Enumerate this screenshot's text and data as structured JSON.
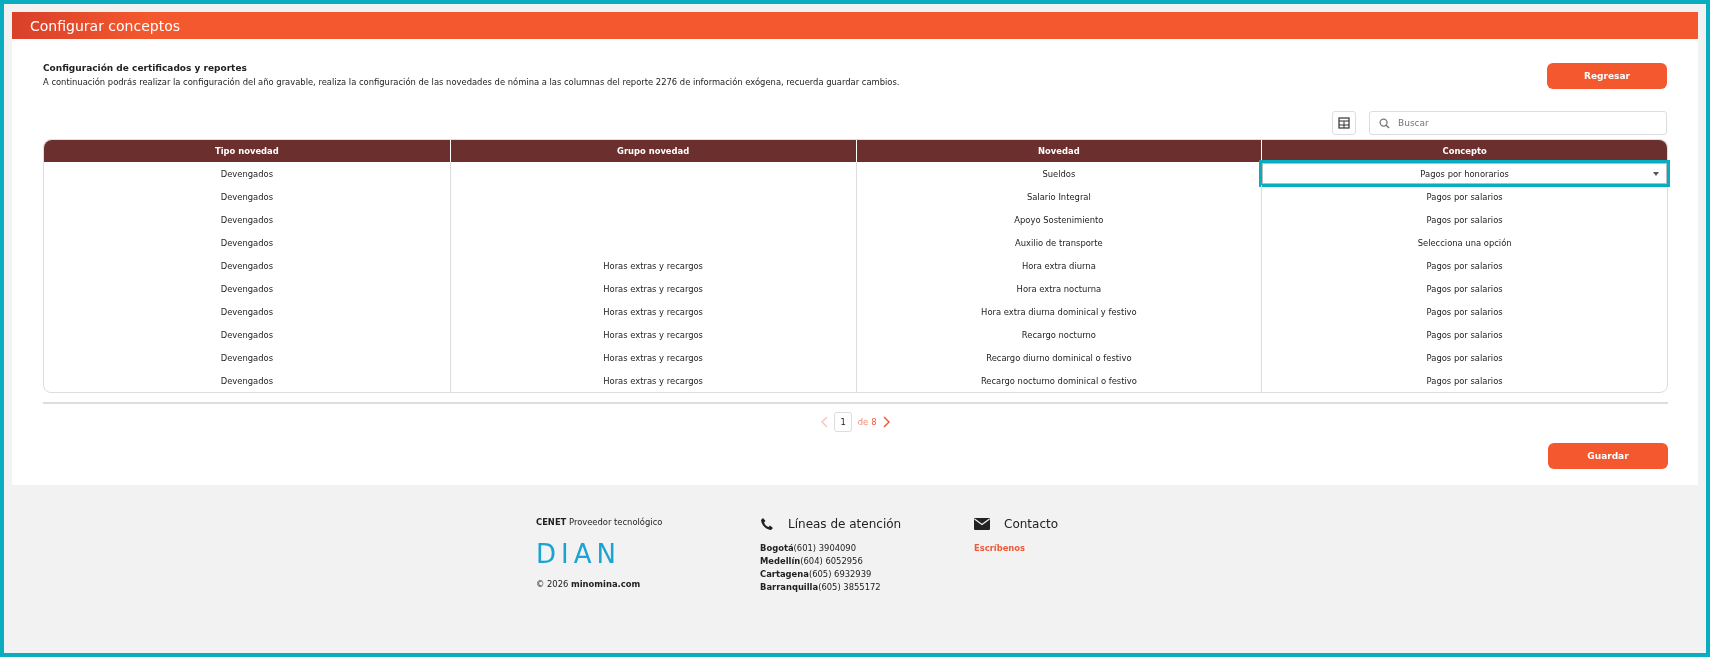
{
  "header": {
    "title": "Configurar conceptos"
  },
  "intro": {
    "heading": "Configuración de certificados y reportes",
    "text": "A continuación podrás realizar la configuración del año gravable, realiza la configuración de las novedades de nómina a las columnas del reporte 2276 de información exógena, recuerda guardar cambios."
  },
  "back_button": "Regresar",
  "search": {
    "placeholder": "Buscar"
  },
  "table": {
    "columns": [
      "Tipo novedad",
      "Grupo novedad",
      "Novedad",
      "Concepto"
    ],
    "rows": [
      {
        "tipo": "Devengados",
        "grupo": "",
        "novedad": "Sueldos",
        "concepto": {
          "kind": "select",
          "value": "Pagos por honorarios",
          "focused": true
        }
      },
      {
        "tipo": "Devengados",
        "grupo": "",
        "novedad": "Salario Integral",
        "concepto": {
          "kind": "text",
          "value": "Pagos por salarios"
        }
      },
      {
        "tipo": "Devengados",
        "grupo": "",
        "novedad": "Apoyo Sostenimiento",
        "concepto": {
          "kind": "text",
          "value": "Pagos por salarios"
        }
      },
      {
        "tipo": "Devengados",
        "grupo": "",
        "novedad": "Auxilio de transporte",
        "concepto": {
          "kind": "text",
          "value": "Selecciona una opción"
        }
      },
      {
        "tipo": "Devengados",
        "grupo": "Horas extras y recargos",
        "novedad": "Hora extra diurna",
        "concepto": {
          "kind": "text",
          "value": "Pagos por salarios"
        }
      },
      {
        "tipo": "Devengados",
        "grupo": "Horas extras y recargos",
        "novedad": "Hora extra nocturna",
        "concepto": {
          "kind": "text",
          "value": "Pagos por salarios"
        }
      },
      {
        "tipo": "Devengados",
        "grupo": "Horas extras y recargos",
        "novedad": "Hora extra diurna dominical y festivo",
        "concepto": {
          "kind": "text",
          "value": "Pagos por salarios"
        }
      },
      {
        "tipo": "Devengados",
        "grupo": "Horas extras y recargos",
        "novedad": "Recargo nocturno",
        "concepto": {
          "kind": "text",
          "value": "Pagos por salarios"
        }
      },
      {
        "tipo": "Devengados",
        "grupo": "Horas extras y recargos",
        "novedad": "Recargo diurno dominical o festivo",
        "concepto": {
          "kind": "text",
          "value": "Pagos por salarios"
        }
      },
      {
        "tipo": "Devengados",
        "grupo": "Horas extras y recargos",
        "novedad": "Recargo nocturno dominical o festivo",
        "concepto": {
          "kind": "text",
          "value": "Pagos por salarios"
        }
      }
    ]
  },
  "pagination": {
    "page": "1",
    "of": "de",
    "total": "8",
    "prev_disabled": true
  },
  "save_button": "Guardar",
  "footer": {
    "provider": "**CENET** Proveedor tecnológico",
    "logo": "DIAN",
    "copyright": "© 2026 **minomina.com**",
    "lines_title": "Líneas de atención",
    "lines": [
      "**Bogotá**(601) 3904090",
      "**Medellín**(604) 6052956",
      "**Cartagena**(605) 6932939",
      "**Barranquilla**(605) 3855172"
    ],
    "contact_title": "Contacto",
    "contact_link": "Escríbenos"
  }
}
